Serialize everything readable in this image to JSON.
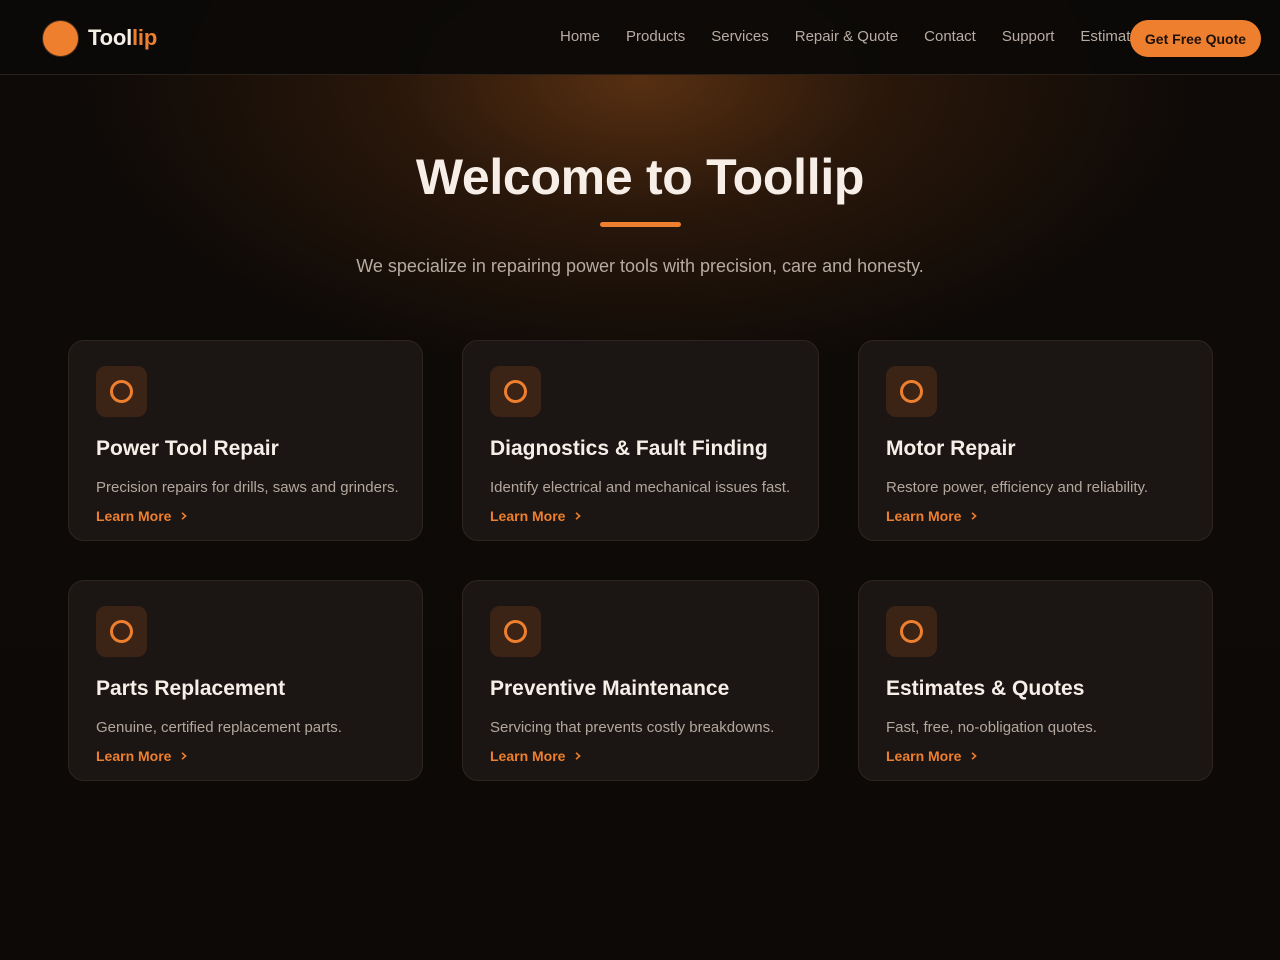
{
  "header": {
    "brand_a": "Tool",
    "brand_b": "lip",
    "nav": [
      "Home",
      "Products",
      "Services",
      "Repair & Quote",
      "Contact",
      "Support",
      "Estimat"
    ],
    "cta_label": "Get Free Quote"
  },
  "hero": {
    "title": "Welcome to Toollip",
    "subtitle": "We specialize in repairing power tools with precision, care and honesty."
  },
  "services": [
    {
      "title": "Power Tool Repair",
      "description": "Precision repairs for drills, saws and grinders.",
      "link": "Learn More",
      "icon": "ring-icon"
    },
    {
      "title": "Diagnostics & Fault Finding",
      "description": "Identify electrical and mechanical issues fast.",
      "link": "Learn More",
      "icon": "ring-icon"
    },
    {
      "title": "Motor Repair",
      "description": "Restore power, efficiency and reliability.",
      "link": "Learn More",
      "icon": "ring-icon"
    },
    {
      "title": "Parts Replacement",
      "description": "Genuine, certified replacement parts.",
      "link": "Learn More",
      "icon": "ring-icon"
    },
    {
      "title": "Preventive Maintenance",
      "description": "Servicing that prevents costly breakdowns.",
      "link": "Learn More",
      "icon": "ring-icon"
    },
    {
      "title": "Estimates & Quotes",
      "description": "Fast, free, no-obligation quotes.",
      "link": "Learn More",
      "icon": "ring-icon"
    }
  ],
  "colors": {
    "accent": "#ee7f2e",
    "background": "#0e0a07",
    "card": "#1b1613",
    "muted_text": "#b3a79d"
  }
}
